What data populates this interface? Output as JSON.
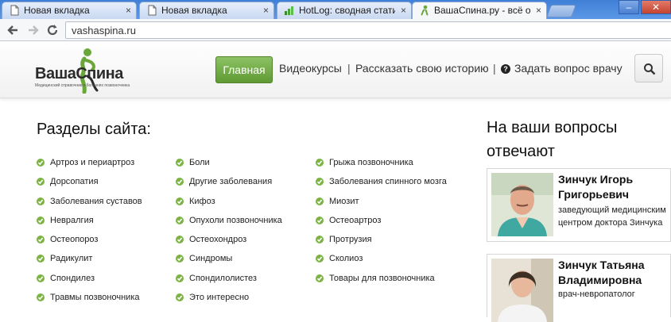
{
  "browser": {
    "tabs": [
      {
        "title": "Новая вкладка",
        "active": false
      },
      {
        "title": "Новая вкладка",
        "active": false
      },
      {
        "title": "HotLog: сводная статистик",
        "active": false
      },
      {
        "title": "ВашаСпина.ру - всё о лечен",
        "active": true
      }
    ],
    "close_glyph": "×",
    "url": "vashaspina.ru",
    "window_controls": {
      "minimize": "–",
      "maximize": "□",
      "close": "✕"
    }
  },
  "site": {
    "logo": {
      "word1": "Ваша",
      "word2": "Спина",
      "tagline": "Медицинский справочник о болезнях позвоночника"
    },
    "nav": {
      "main": "Главная",
      "courses": "Видеокурсы",
      "separator": "|",
      "story": "Рассказать свою историю",
      "ask": "Задать вопрос врачу",
      "ask_icon": "?"
    },
    "colors": {
      "accent_green": "#6aa73a",
      "check_green": "#7cb342"
    },
    "sections": {
      "title": "Разделы сайта:",
      "col1": [
        "Артроз и периартроз",
        "Дорсопатия",
        "Заболевания суставов",
        "Невралгия",
        "Остеопороз",
        "Радикулит",
        "Спондилез",
        "Травмы позвоночника"
      ],
      "col2": [
        "Боли",
        "Другие заболевания",
        "Кифоз",
        "Опухоли позвоночника",
        "Остеохондроз",
        "Синдромы",
        "Спондилолистез",
        "Это интересно"
      ],
      "col3": [
        "Грыжа позвоночника",
        "Заболевания спинного мозга",
        "Миозит",
        "Остеоартроз",
        "Протрузия",
        "Сколиоз",
        "Товары для позвоночника"
      ]
    },
    "experts": {
      "title": "На ваши вопросы отвечают",
      "doctors": [
        {
          "name": "Зинчук Игорь Григорьевич",
          "desc": "заведующий медицинским центром доктора Зинчука"
        },
        {
          "name": "Зинчук Татьяна Владимировна",
          "desc": "врач-невропатолог"
        }
      ]
    }
  }
}
